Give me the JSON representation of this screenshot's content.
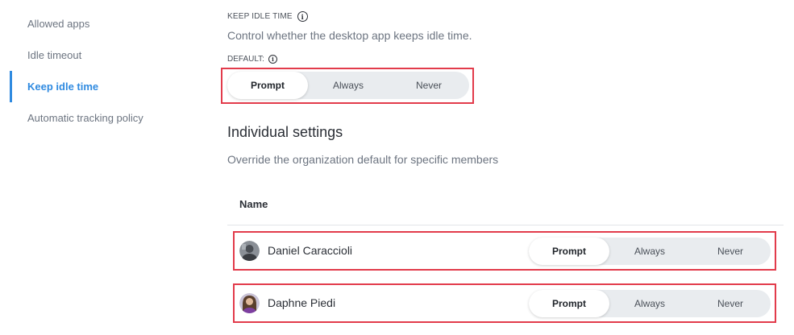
{
  "sidebar": {
    "items": [
      {
        "label": "Allowed apps",
        "active": false
      },
      {
        "label": "Idle timeout",
        "active": false
      },
      {
        "label": "Keep idle time",
        "active": true
      },
      {
        "label": "Automatic tracking policy",
        "active": false
      }
    ]
  },
  "setting": {
    "kicker": "KEEP IDLE TIME",
    "description": "Control whether the desktop app keeps idle time.",
    "default_label": "DEFAULT:",
    "options": [
      "Prompt",
      "Always",
      "Never"
    ],
    "selected": "Prompt"
  },
  "individual": {
    "title": "Individual settings",
    "description": "Override the organization default for specific members",
    "column_name": "Name",
    "members": [
      {
        "name": "Daniel Caraccioli",
        "options": [
          "Prompt",
          "Always",
          "Never"
        ],
        "selected": "Prompt"
      },
      {
        "name": "Daphne Piedi",
        "options": [
          "Prompt",
          "Always",
          "Never"
        ],
        "selected": "Prompt"
      }
    ]
  },
  "colors": {
    "accent": "#2f8ae0",
    "highlight_border": "#e23b4b",
    "segment_bg": "#e9ecef"
  }
}
